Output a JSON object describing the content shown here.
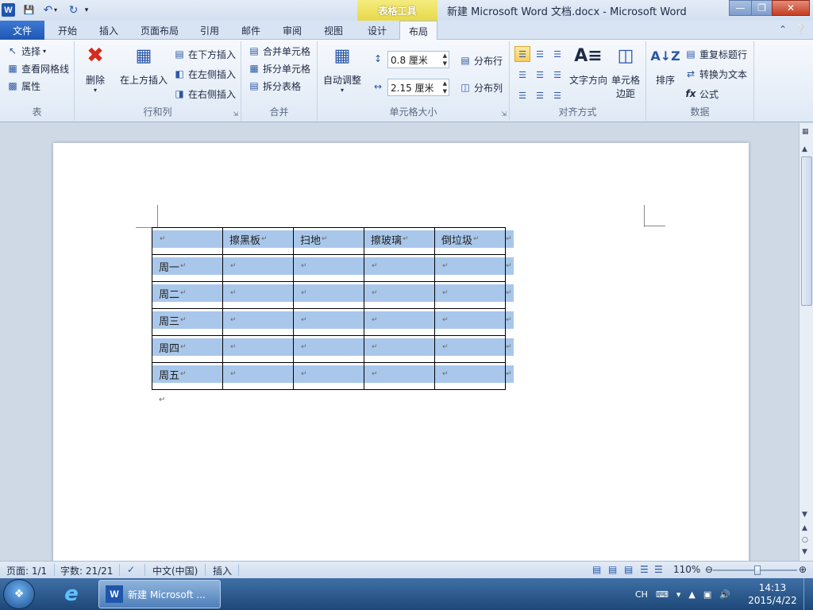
{
  "titlebar": {
    "context_tab": "表格工具",
    "title": "新建 Microsoft Word 文档.docx - Microsoft Word",
    "logo": "W"
  },
  "tabs": [
    {
      "label": "文件"
    },
    {
      "label": "开始"
    },
    {
      "label": "插入"
    },
    {
      "label": "页面布局"
    },
    {
      "label": "引用"
    },
    {
      "label": "邮件"
    },
    {
      "label": "审阅"
    },
    {
      "label": "视图"
    },
    {
      "label": "设计"
    },
    {
      "label": "布局"
    }
  ],
  "ribbon": {
    "table": {
      "select": "选择",
      "gridlines": "查看网格线",
      "properties": "属性",
      "label": "表"
    },
    "rows_cols": {
      "delete": "删除",
      "insert_above": "在上方插入",
      "insert_below": "在下方插入",
      "insert_left": "在左侧插入",
      "insert_right": "在右侧插入",
      "label": "行和列"
    },
    "merge": {
      "merge_cells": "合并单元格",
      "split_cells": "拆分单元格",
      "split_table": "拆分表格",
      "label": "合并"
    },
    "cell_size": {
      "autofit": "自动调整",
      "height": "0.8 厘米",
      "width": "2.15 厘米",
      "dist_rows": "分布行",
      "dist_cols": "分布列",
      "label": "单元格大小"
    },
    "alignment": {
      "text_direction": "文字方向",
      "cell_margins_1": "单元格",
      "cell_margins_2": "边距",
      "label": "对齐方式"
    },
    "data": {
      "sort": "排序",
      "repeat_header": "重复标题行",
      "convert_text": "转换为文本",
      "formula": "公式",
      "label": "数据"
    }
  },
  "doc_table": {
    "rows": [
      [
        "",
        "擦黑板",
        "扫地",
        "擦玻璃",
        "倒垃圾"
      ],
      [
        "周一",
        "",
        "",
        "",
        ""
      ],
      [
        "周二",
        "",
        "",
        "",
        ""
      ],
      [
        "周三",
        "",
        "",
        "",
        ""
      ],
      [
        "周四",
        "",
        "",
        "",
        ""
      ],
      [
        "周五",
        "",
        "",
        "",
        ""
      ]
    ],
    "mark": "↵"
  },
  "statusbar": {
    "page": "页面: 1/1",
    "words": "字数: 21/21",
    "language": "中文(中国)",
    "mode": "插入",
    "zoom": "110%"
  },
  "taskbar": {
    "word_task": "新建 Microsoft ...",
    "ime": "CH",
    "time": "14:13",
    "date": "2015/4/22"
  }
}
